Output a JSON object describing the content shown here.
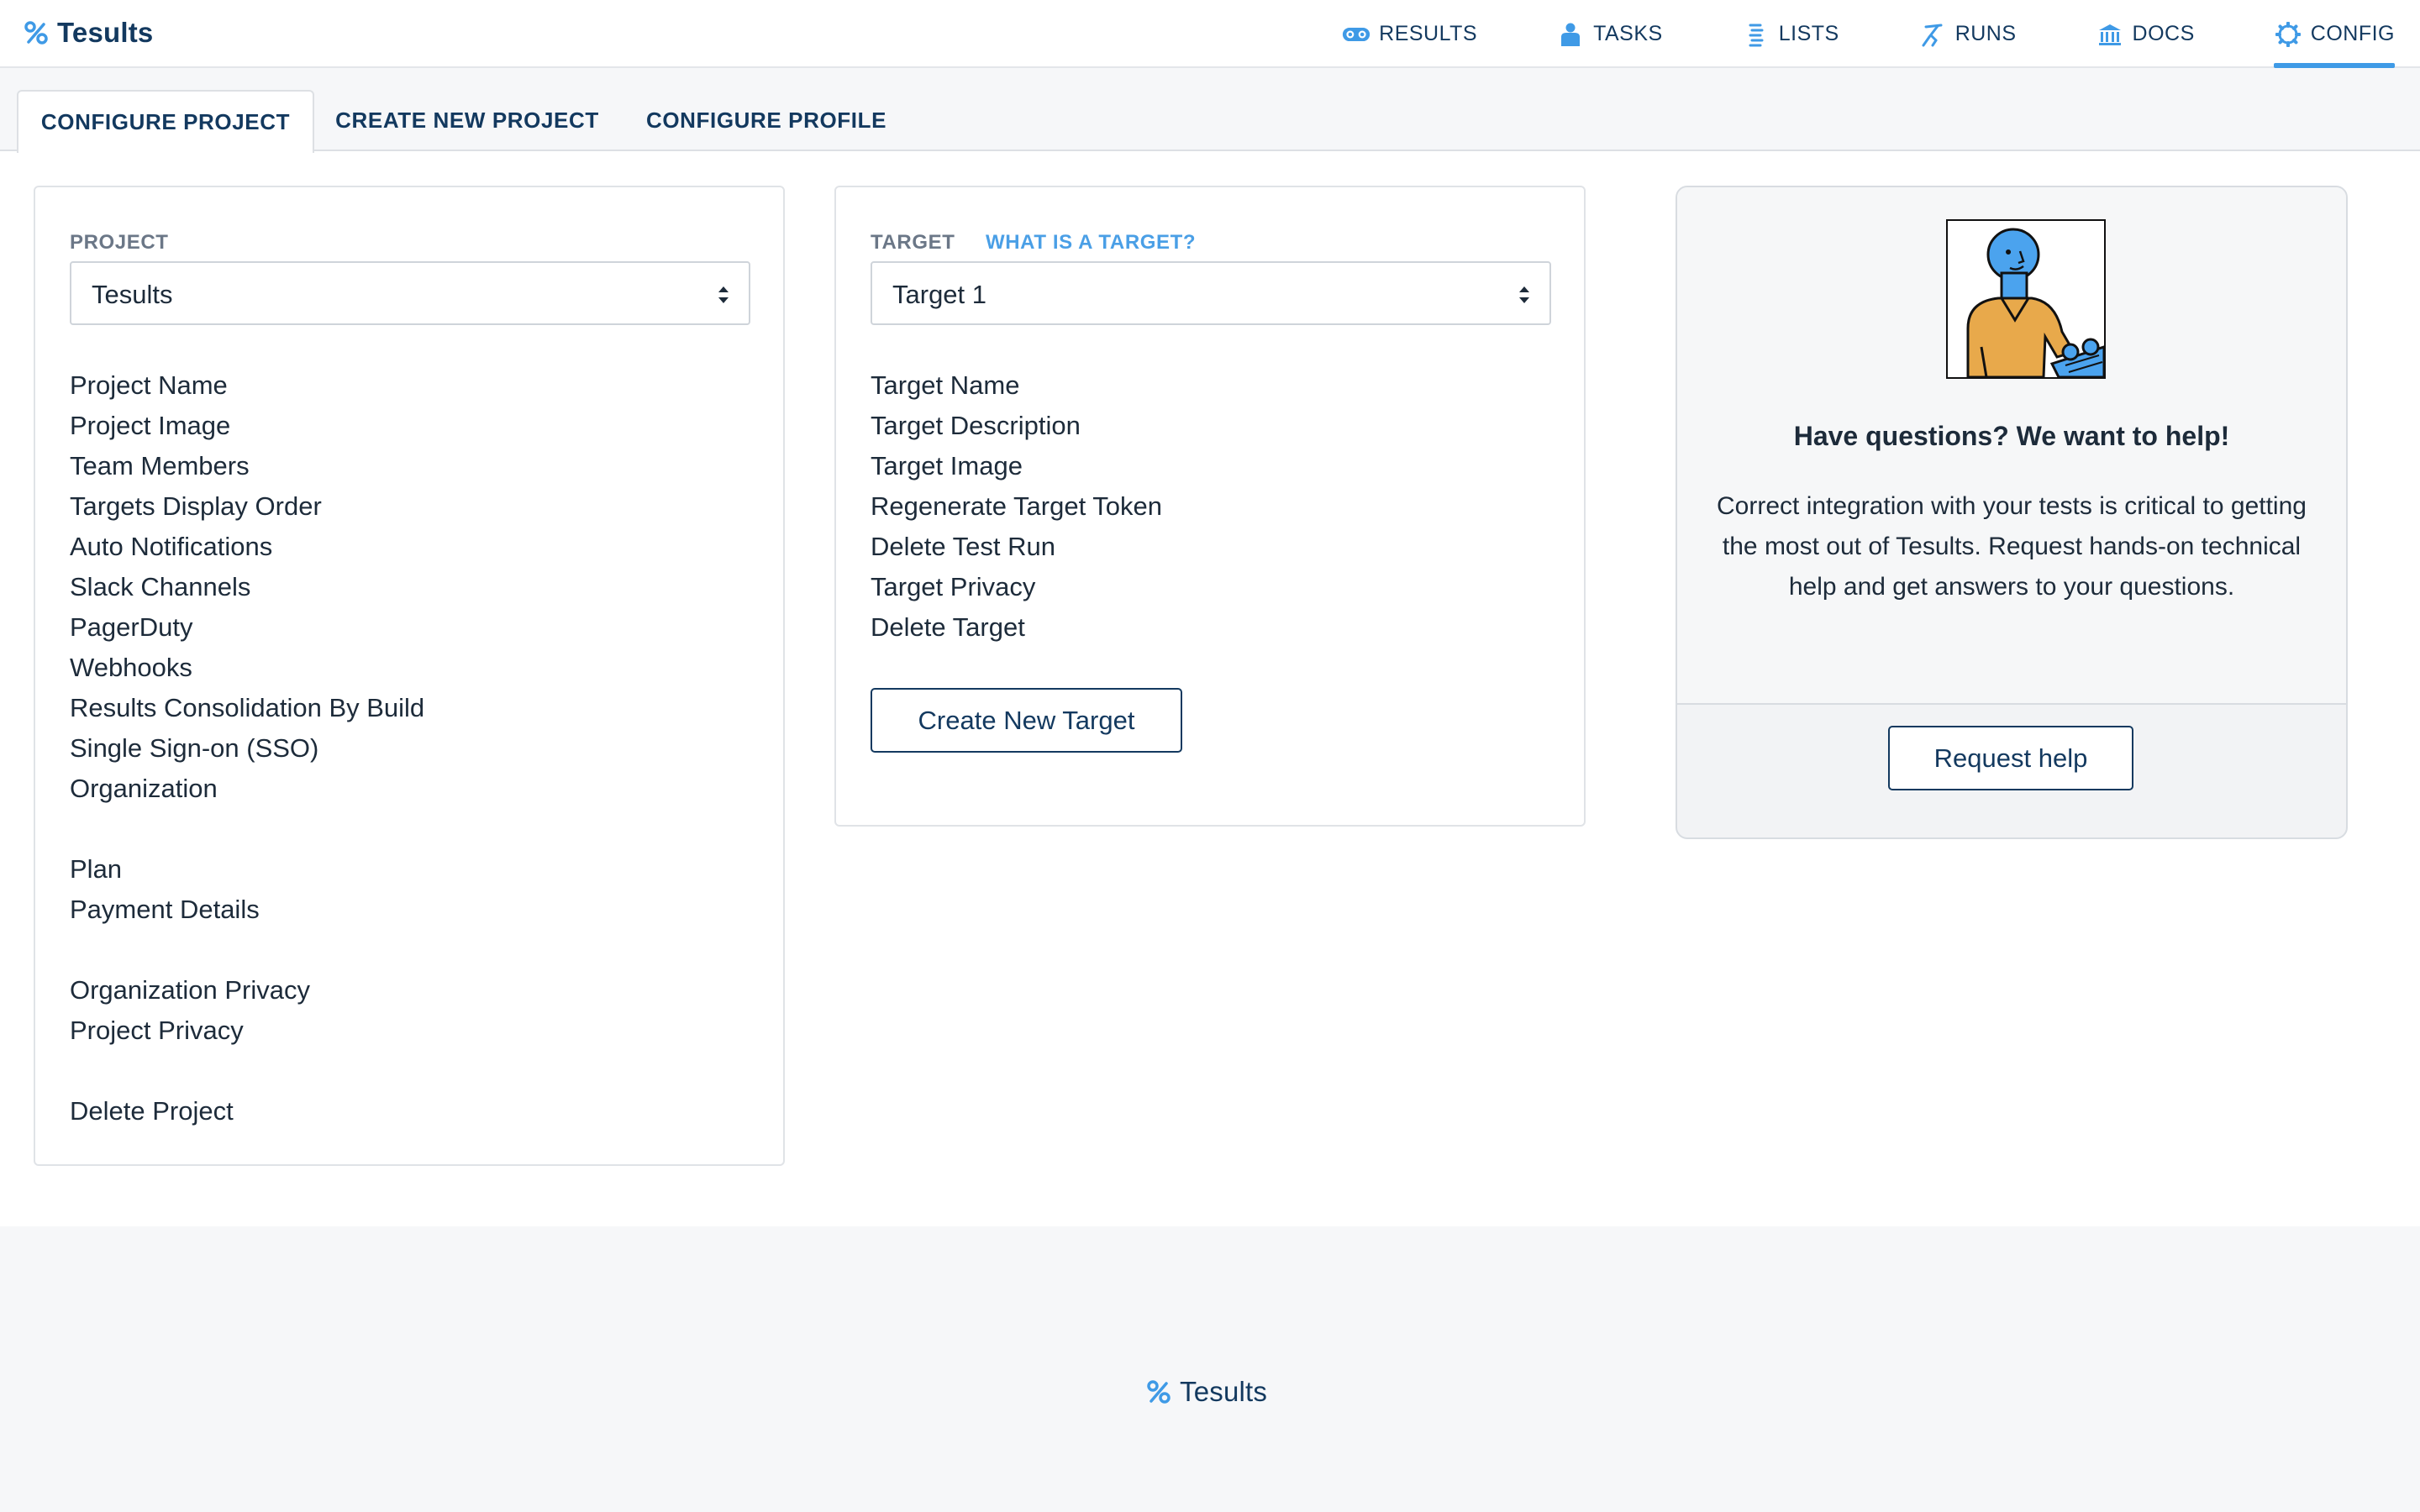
{
  "app": {
    "name": "Tesults"
  },
  "nav": [
    {
      "label": "RESULTS",
      "icon": "results-icon",
      "active": false
    },
    {
      "label": "TASKS",
      "icon": "tasks-icon",
      "active": false
    },
    {
      "label": "LISTS",
      "icon": "lists-icon",
      "active": false
    },
    {
      "label": "RUNS",
      "icon": "runs-icon",
      "active": false
    },
    {
      "label": "DOCS",
      "icon": "docs-icon",
      "active": false
    },
    {
      "label": "CONFIG",
      "icon": "config-icon",
      "active": true
    }
  ],
  "tabs": [
    {
      "label": "CONFIGURE PROJECT",
      "active": true
    },
    {
      "label": "CREATE NEW PROJECT",
      "active": false
    },
    {
      "label": "CONFIGURE PROFILE",
      "active": false
    }
  ],
  "project_panel": {
    "label": "PROJECT",
    "selected": "Tesults",
    "items": [
      "Project Name",
      "Project Image",
      "Team Members",
      "Targets Display Order",
      "Auto Notifications",
      "Slack Channels",
      "PagerDuty",
      "Webhooks",
      "Results Consolidation By Build",
      "Single Sign-on (SSO)",
      "Organization",
      "Plan",
      "Payment Details",
      "Organization Privacy",
      "Project Privacy",
      "Delete Project"
    ]
  },
  "target_panel": {
    "label": "TARGET",
    "help_link": "WHAT IS A TARGET?",
    "selected": "Target 1",
    "items": [
      "Target Name",
      "Target Description",
      "Target Image",
      "Regenerate Target Token",
      "Delete Test Run",
      "Target Privacy",
      "Delete Target"
    ],
    "create_button": "Create New Target"
  },
  "help_card": {
    "title": "Have questions? We want to help!",
    "body": "Correct integration with your tests is critical to getting the most out of Tesults. Request hands-on technical help and get answers to your questions.",
    "button": "Request help"
  },
  "footer": {
    "brand": "Tesults"
  },
  "colors": {
    "brand": "#13395f",
    "accent": "#3f9ae6",
    "link": "#4a9fe6"
  }
}
